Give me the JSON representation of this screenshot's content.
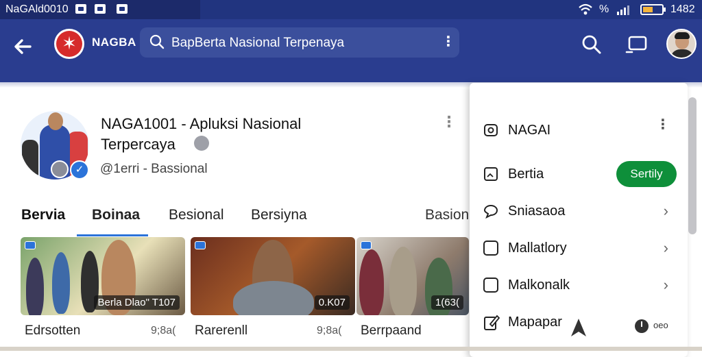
{
  "status_bar": {
    "title": "NaGAld0010",
    "signal": "%",
    "time": "1482"
  },
  "app_bar": {
    "brand": "NAGBA",
    "search_text": "BapBerta Nasional Terpenaya",
    "icons": [
      "back-arrow-icon",
      "search-icon",
      "cast-icon",
      "profile-avatar"
    ]
  },
  "channel": {
    "title": "NAGA1001 - Apluksi Nasional Terpercaya",
    "handle": "@1erri - Bassional",
    "verified": "✓"
  },
  "tabs": [
    {
      "label": "Bervia",
      "active": true
    },
    {
      "label": "Boinaa",
      "active": false
    },
    {
      "label": "Besional",
      "active": false
    },
    {
      "label": "Bersiyna",
      "active": false
    },
    {
      "label": "Basion",
      "active": false
    }
  ],
  "videos": [
    {
      "overlay": "Berla Dlao\" T107",
      "caption": "Edrsotten",
      "views": "9;8a(",
      "tag": "◉"
    },
    {
      "overlay": "0.K07",
      "caption": "Rarerenll",
      "views": "9;8a(",
      "tag": "◉"
    },
    {
      "overlay": "1(63(",
      "caption": "Berrpaand",
      "views": "",
      "tag": "◉"
    }
  ],
  "menu": {
    "header": "NAGAI",
    "items": [
      {
        "label": "Bertia",
        "icon": "image-icon",
        "action": "Sertily"
      },
      {
        "label": "Sniasaoa",
        "icon": "speech-bubble-icon"
      },
      {
        "label": "Mallatlory",
        "icon": "checkbox-icon"
      },
      {
        "label": "Malkonalk",
        "icon": "checkbox-icon"
      },
      {
        "label": "Mapapar",
        "icon": "edit-icon",
        "extra": "oeo"
      }
    ]
  },
  "colors": {
    "app_bar": "#2a3d8f",
    "accent": "#2b73d9",
    "action_pill": "#0e8f3a"
  }
}
